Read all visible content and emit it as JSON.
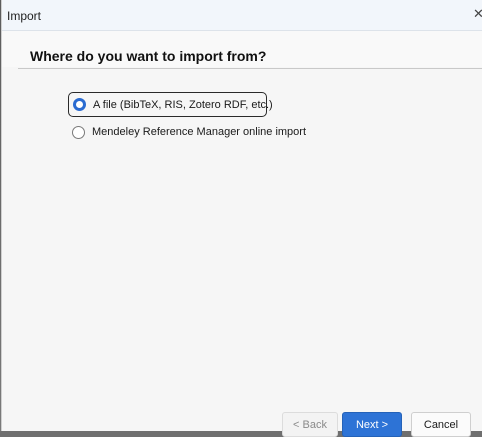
{
  "window": {
    "title": "Import",
    "heading": "Where do you want to import from?"
  },
  "options": [
    {
      "label": "A file (BibTeX, RIS, Zotero RDF, etc.)",
      "selected": true
    },
    {
      "label": "Mendeley Reference Manager online import",
      "selected": false
    }
  ],
  "buttons": {
    "back": "< Back",
    "next": "Next >",
    "cancel": "Cancel"
  },
  "icons": {
    "close": "close-icon",
    "radio_selected": "radio-selected-icon",
    "radio_unselected": "radio-unselected-icon"
  },
  "colors": {
    "accent": "#2a6bd1",
    "primary_button": "#2d73d6"
  }
}
